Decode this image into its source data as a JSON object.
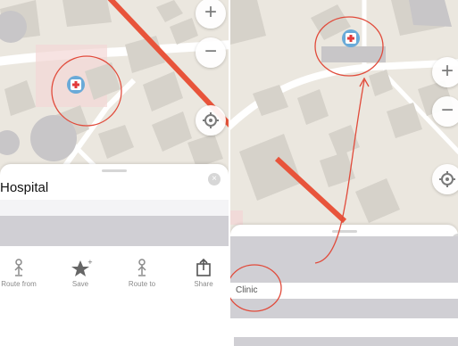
{
  "left": {
    "zoom_in": "+",
    "zoom_out": "−",
    "sheet": {
      "title": "Hospital",
      "close": "×",
      "actions": [
        {
          "label": "Route from",
          "icon": "route-from-icon"
        },
        {
          "label": "Save",
          "icon": "star-icon"
        },
        {
          "label": "Route to",
          "icon": "route-to-icon"
        },
        {
          "label": "Share",
          "icon": "share-icon"
        }
      ]
    }
  },
  "right": {
    "zoom_in": "+",
    "zoom_out": "−",
    "sheet": {
      "close": "×",
      "row_label": "Clinic"
    }
  },
  "colors": {
    "map_bg": "#ebe7df",
    "building": "#d6d2ca",
    "road_red": "#e8543b",
    "annotation_red": "#e14b3b",
    "poi_marker": "#6aaad8"
  }
}
